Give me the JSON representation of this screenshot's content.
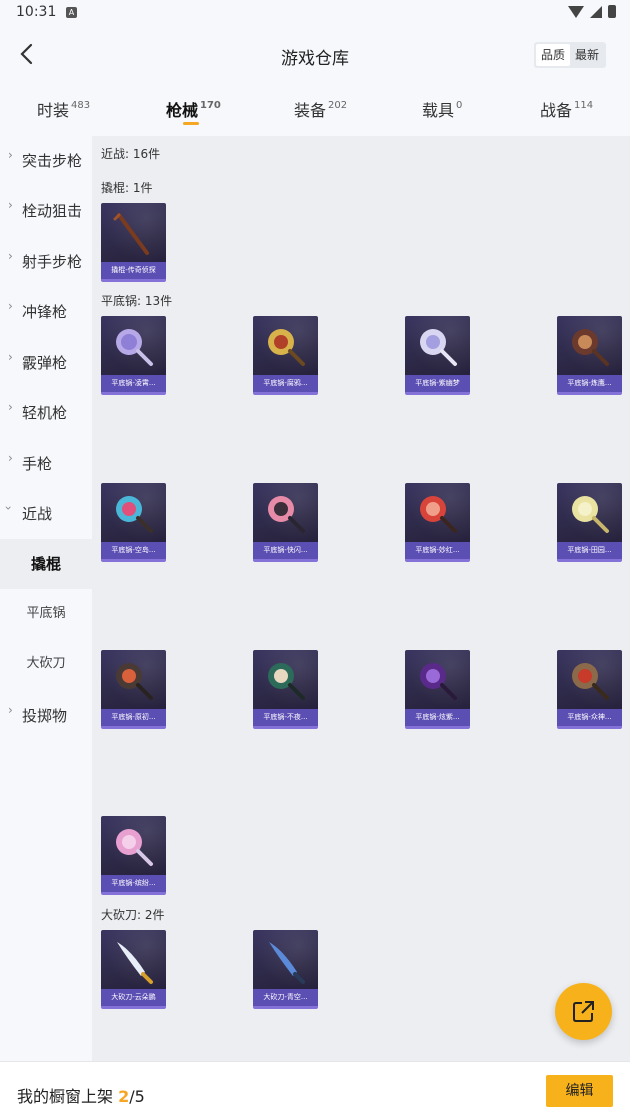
{
  "status": {
    "time": "10:31",
    "notification": "A"
  },
  "header": {
    "title": "游戏仓库",
    "sort_quality": "品质",
    "sort_latest": "最新"
  },
  "tabs": [
    {
      "label": "时装",
      "count": "483"
    },
    {
      "label": "枪械",
      "count": "170"
    },
    {
      "label": "装备",
      "count": "202"
    },
    {
      "label": "载具",
      "count": "0"
    },
    {
      "label": "战备",
      "count": "114"
    }
  ],
  "sidebar": {
    "categories": [
      "突击步枪",
      "栓动狙击",
      "射手步枪",
      "冲锋枪",
      "霰弹枪",
      "轻机枪",
      "手枪",
      "近战",
      "投掷物"
    ],
    "sub": [
      "撬棍",
      "平底锅",
      "大砍刀"
    ]
  },
  "content": {
    "section_melee": "近战: 16件",
    "section_crowbar": "撬棍: 1件",
    "section_pan": "平底锅: 13件",
    "section_machete": "大砍刀: 2件",
    "crowbar_items": [
      "撬棍-传奇侦探"
    ],
    "pan_items": [
      "平底锅-凌霄...",
      "平底锅-腐鸦...",
      "平底锅-紫幽梦",
      "平底锅-炼鹰...",
      "平底锅-空岛...",
      "平底锅-快闪...",
      "平底锅-妙红...",
      "平底锅-田园...",
      "平底锅-原初...",
      "平底锅-不夜...",
      "平底锅-炫紫...",
      "平底锅-众神...",
      "平底锅-缤纷..."
    ],
    "machete_items": [
      "大砍刀-云朵鹏",
      "大砍刀-青空..."
    ]
  },
  "bottom": {
    "shelf_label": "我的橱窗上架 ",
    "shelf_current": "2",
    "shelf_sep": "/",
    "shelf_max": "5",
    "edit_label": "编辑"
  },
  "colors": {
    "accent": "#f7b21b",
    "card_bg": "#2b2744",
    "card_label": "#5c4fb4"
  }
}
